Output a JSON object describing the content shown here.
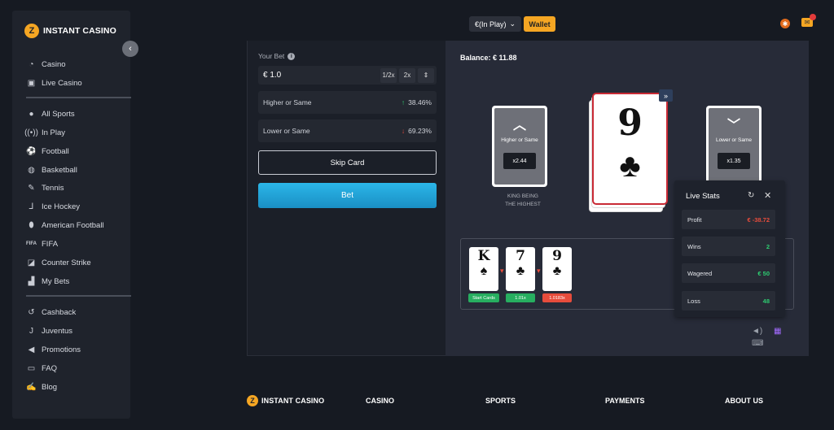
{
  "brand": {
    "logo_text": "INSTANT CASINO",
    "logo_glyph": "Z"
  },
  "sidebar": {
    "items": [
      {
        "label": "Casino",
        "icon": "casino-icon"
      },
      {
        "label": "Live Casino",
        "icon": "live-casino-icon"
      },
      {
        "label": "All Sports",
        "icon": "sports-ball-icon"
      },
      {
        "label": "In Play",
        "icon": "broadcast-icon"
      },
      {
        "label": "Football",
        "icon": "football-icon"
      },
      {
        "label": "Basketball",
        "icon": "basketball-icon"
      },
      {
        "label": "Tennis",
        "icon": "tennis-icon"
      },
      {
        "label": "Ice Hockey",
        "icon": "hockey-icon"
      },
      {
        "label": "American Football",
        "icon": "american-football-icon"
      },
      {
        "label": "FIFA",
        "icon": "fifa-icon"
      },
      {
        "label": "Counter Strike",
        "icon": "counter-strike-icon"
      },
      {
        "label": "My Bets",
        "icon": "my-bets-icon"
      },
      {
        "label": "Cashback",
        "icon": "cashback-icon"
      },
      {
        "label": "Juventus",
        "icon": "juventus-icon"
      },
      {
        "label": "Promotions",
        "icon": "megaphone-icon"
      },
      {
        "label": "FAQ",
        "icon": "chat-icon"
      },
      {
        "label": "Blog",
        "icon": "blog-icon"
      }
    ],
    "fifa_glyph": "FIFA"
  },
  "topbar": {
    "currency": "€(In Play)",
    "wallet": "Wallet"
  },
  "bet_panel": {
    "your_bet_label": "Your Bet",
    "bet_value": "€ 1.0",
    "half": "1/2x",
    "double": "2x",
    "higher_label": "Higher or Same",
    "higher_pct": "38.46%",
    "lower_label": "Lower or Same",
    "lower_pct": "69.23%",
    "skip_label": "Skip Card",
    "bet_label": "Bet"
  },
  "game": {
    "balance": "Balance: € 11.88",
    "higher_card": {
      "label": "Higher or Same",
      "mult": "x2.44"
    },
    "lower_card": {
      "label": "Lower or Same",
      "mult": "x1.35"
    },
    "king_note_1": "KING BEING",
    "king_note_2": "THE HIGHEST",
    "current_card": {
      "rank": "9",
      "suit": "♣"
    },
    "history": [
      {
        "rank": "K",
        "suit": "♠",
        "tag": "Start Cards",
        "tag_color": "#27ae60"
      },
      {
        "rank": "7",
        "suit": "♣",
        "tag": "1.01x",
        "tag_color": "#27ae60"
      },
      {
        "rank": "9",
        "suit": "♣",
        "tag": "1.0183x",
        "tag_color": "#e74c3c"
      }
    ]
  },
  "live_stats": {
    "title": "Live Stats",
    "rows": [
      {
        "label": "Profit",
        "value": "€ -38.72"
      },
      {
        "label": "Wins",
        "value": "2"
      },
      {
        "label": "Wagered",
        "value": "€ 50"
      },
      {
        "label": "Loss",
        "value": "48"
      }
    ]
  },
  "footer": {
    "logo_text": "INSTANT CASINO",
    "links": [
      "CASINO",
      "SPORTS",
      "PAYMENTS",
      "ABOUT US"
    ]
  }
}
